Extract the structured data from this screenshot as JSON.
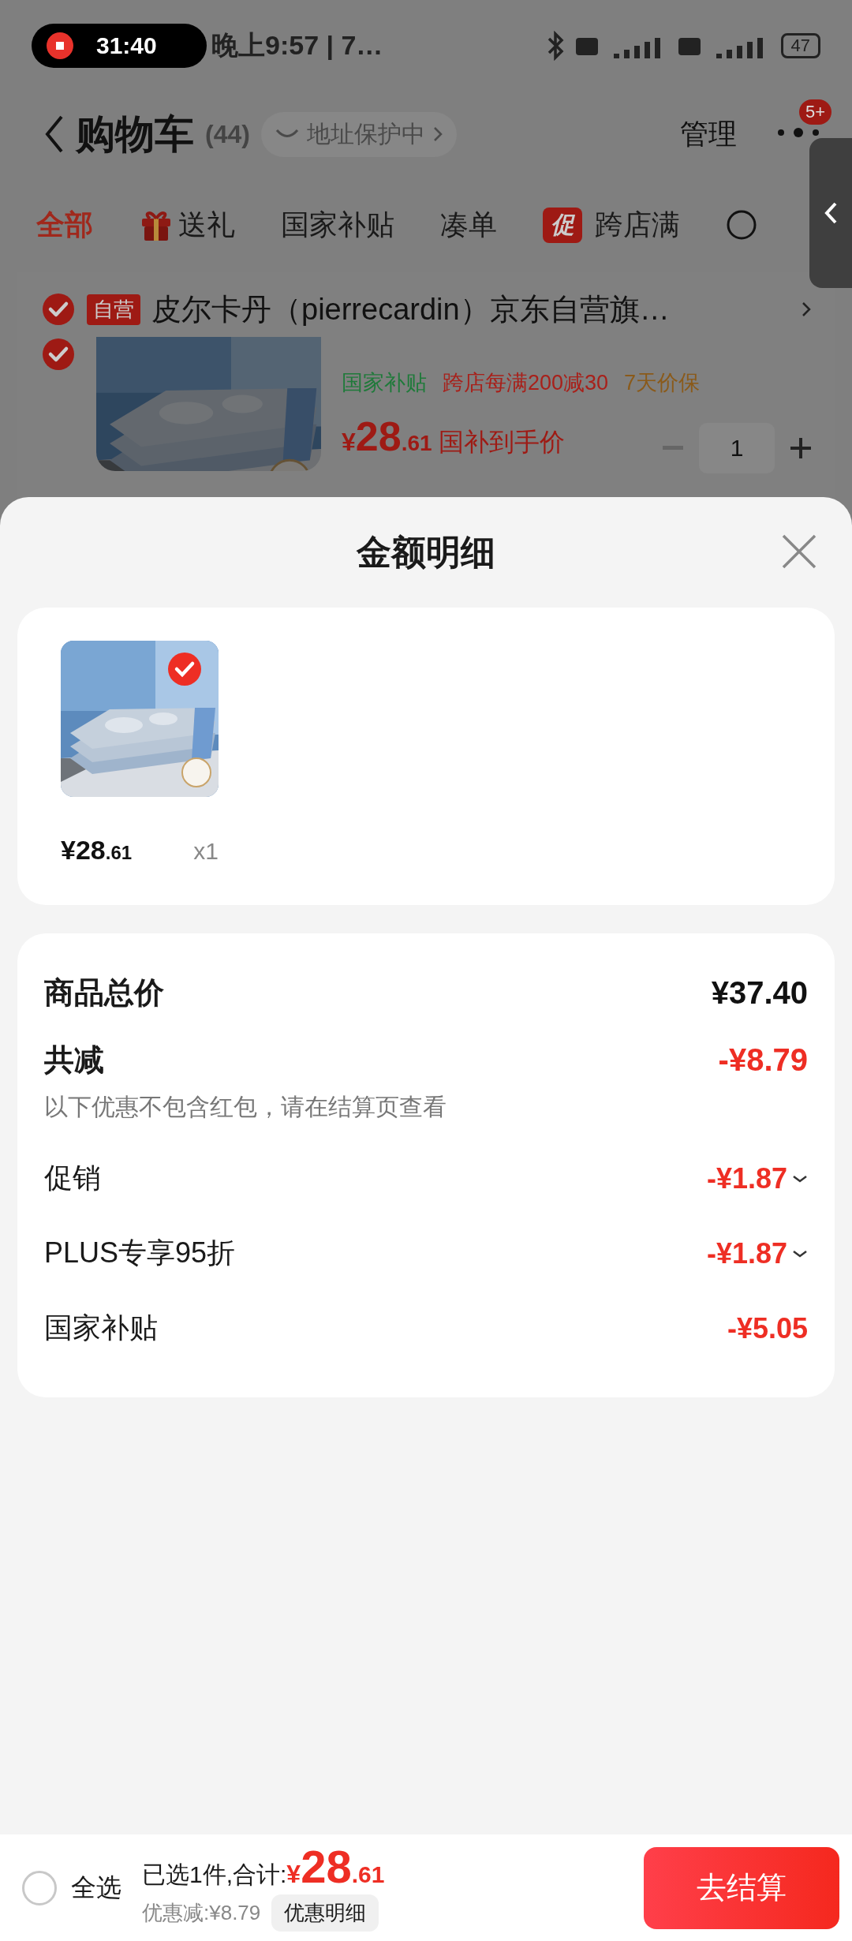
{
  "status_bar": {
    "recording_time": "31:40",
    "time": "晚上9:57 | 7…",
    "battery": "47"
  },
  "header": {
    "title": "购物车",
    "count": "(44)",
    "address_badge": "地址保护中",
    "manage": "管理",
    "badge": "5+"
  },
  "tabs": [
    {
      "label": "全部",
      "selected": true,
      "kind": "text"
    },
    {
      "label": "送礼",
      "selected": false,
      "kind": "gift"
    },
    {
      "label": "国家补贴",
      "selected": false,
      "kind": "text"
    },
    {
      "label": "凑单",
      "selected": false,
      "kind": "text"
    },
    {
      "label": "跨店满",
      "selected": false,
      "kind": "promo",
      "badge": "促"
    }
  ],
  "cart_store": {
    "checked": true,
    "tag": "自营",
    "name": "皮尔卡丹（pierrecardin）京东自营旗…"
  },
  "cart_item": {
    "checked": true,
    "tags": [
      {
        "text": "国家补贴",
        "color": "#1f7a3a"
      },
      {
        "text": "跨店每满200减30",
        "color": "#a8201a"
      },
      {
        "text": "7天价保",
        "color": "#8a5a1a"
      }
    ],
    "price_symbol": "¥",
    "price_int": "28",
    "price_dec": ".61",
    "price_note": "国补到手价",
    "quantity": "1"
  },
  "sheet": {
    "title": "金额明细",
    "items": [
      {
        "selected": true,
        "price": "¥28",
        "price_dec": ".61",
        "quantity": "x1"
      }
    ],
    "total_label": "商品总价",
    "total": "¥37.40",
    "discount_label": "共减",
    "discount": "-¥8.79",
    "note": "以下优惠不包含红包，请在结算页查看",
    "rows": [
      {
        "label": "促销",
        "value": "-¥1.87",
        "expandable": true
      },
      {
        "label": "PLUS专享95折",
        "value": "-¥1.87",
        "expandable": true
      },
      {
        "label": "国家补贴",
        "value": "-¥5.05",
        "expandable": false
      }
    ]
  },
  "bottom_bar": {
    "select_all": {
      "label": "全选",
      "checked": false
    },
    "summary": "已选1件,合计:",
    "price_symbol": "¥",
    "price_int": "28",
    "price_dec": ".61",
    "savings": "优惠减:¥8.79",
    "detail_button": "优惠明细",
    "checkout": "去结算"
  }
}
